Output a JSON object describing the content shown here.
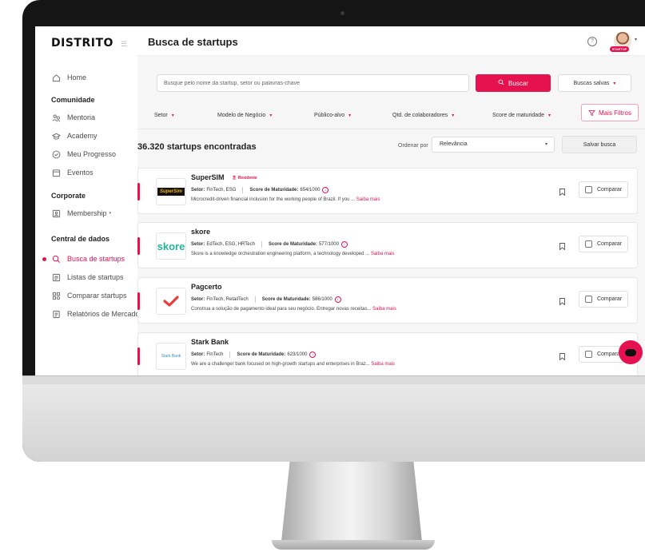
{
  "app": {
    "logo": "DISTRITO",
    "page_title": "Busca de startups",
    "avatar_badge": "STARTUP"
  },
  "sidebar": {
    "items": [
      {
        "label": "Home",
        "icon": "home-icon"
      },
      {
        "section": "Comunidade"
      },
      {
        "label": "Mentoria",
        "icon": "people-icon"
      },
      {
        "label": "Academy",
        "icon": "graduation-cap-icon"
      },
      {
        "label": "Meu Progresso",
        "icon": "check-circle-icon"
      },
      {
        "label": "Eventos",
        "icon": "calendar-icon"
      },
      {
        "section": "Corporate"
      },
      {
        "label": "Membership",
        "icon": "id-card-icon"
      },
      {
        "section": "Central de dados"
      },
      {
        "label": "Busca de startups",
        "icon": "search-icon",
        "active": true
      },
      {
        "label": "Listas de startups",
        "icon": "list-icon"
      },
      {
        "label": "Comparar startups",
        "icon": "grid-compare-icon"
      },
      {
        "label": "Relatórios de Mercado",
        "icon": "report-icon"
      }
    ]
  },
  "search": {
    "placeholder": "Busque pelo nome da startup, setor ou palavras-chave",
    "button_label": "Buscar",
    "saved_label": "Buscas salvas"
  },
  "filters": {
    "items": [
      "Setor",
      "Modelo de Negócio",
      "Público-alvo",
      "Qtd. de colaboradores",
      "Score de maturidade"
    ],
    "more_label": "Mais Filtros"
  },
  "results": {
    "count_label": "36.320 startups encontradas",
    "order_label": "Ordenar por",
    "order_value": "Relevância",
    "save_search_label": "Salvar busca"
  },
  "startups": [
    {
      "name": "SuperSIM",
      "badge": "Residente",
      "sector_label": "Setor:",
      "sector": "FinTech, ESG",
      "score_label": "Score de Maturidade:",
      "score": "654/1000",
      "description": "Microcredit-driven financial inclusion for the working people of Brazil. If you ...",
      "more": "Saiba mais",
      "logo_text": "SuperSim",
      "compare_label": "Comparar"
    },
    {
      "name": "skore",
      "sector_label": "Setor:",
      "sector": "EdTech, ESG, HRTech",
      "score_label": "Score de Maturidade:",
      "score": "577/1000",
      "description": "Skore is a knowledge orchestration engineering platform, a technology developed ...",
      "more": "Saiba mais",
      "logo_text": "skore",
      "compare_label": "Comparar"
    },
    {
      "name": "Pagcerto",
      "sector_label": "Setor:",
      "sector": "FinTech, RetailTech",
      "score_label": "Score de Maturidade:",
      "score": "586/1000",
      "description": "Construa a solução de pagamento ideal para seu negócio. Entregar novas receitas...",
      "more": "Saiba mais",
      "logo_text": "",
      "compare_label": "Comparar"
    },
    {
      "name": "Stark Bank",
      "sector_label": "Setor:",
      "sector": "FinTech",
      "score_label": "Score de Maturidade:",
      "score": "623/1000",
      "description": "We are a challenger bank focused on high-growth startups and enterprises in Braz...",
      "more": "Saiba mais",
      "logo_text": "Stark Bank",
      "compare_label": "Comparar"
    }
  ],
  "colors": {
    "accent": "#e6124f",
    "text": "#1e1e1e",
    "background": "#f6f6f7",
    "skore_green": "#22b59a"
  }
}
